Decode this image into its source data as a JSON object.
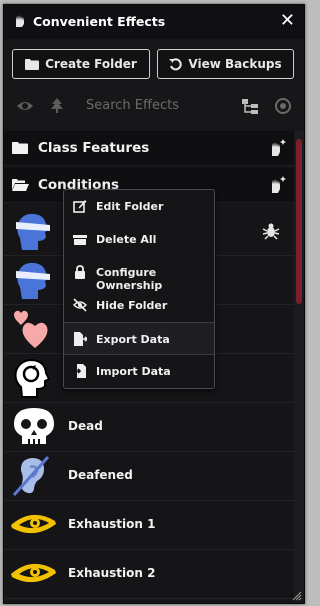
{
  "window": {
    "title": "Convenient Effects",
    "close_glyph": "✕"
  },
  "toolbar": {
    "create_folder": "Create Folder",
    "view_backups": "View Backups"
  },
  "search": {
    "placeholder": "Search Effects"
  },
  "folders": [
    {
      "label": "Class Features"
    },
    {
      "label": "Conditions"
    }
  ],
  "effects": [
    {
      "label": "",
      "icon": "blinded-head-icon"
    },
    {
      "label": "",
      "icon": "blinded-head-icon"
    },
    {
      "label": "",
      "icon": "hearts-icon"
    },
    {
      "label": "",
      "icon": "head-spiral-icon"
    },
    {
      "label": "Dead",
      "icon": "skull-icon"
    },
    {
      "label": "Deafened",
      "icon": "deaf-ear-icon"
    },
    {
      "label": "Exhaustion 1",
      "icon": "yellow-eye-icon"
    },
    {
      "label": "Exhaustion 2",
      "icon": "yellow-eye-icon"
    }
  ],
  "context_menu": {
    "items": [
      {
        "label": "Edit Folder",
        "icon": "edit-icon"
      },
      {
        "label": "Delete All",
        "icon": "trash-icon"
      },
      {
        "label": "Configure Ownership",
        "icon": "lock-icon"
      },
      {
        "label": "Hide Folder",
        "icon": "eye-slash-icon"
      },
      {
        "label": "Export Data",
        "icon": "file-export-icon"
      },
      {
        "label": "Import Data",
        "icon": "file-import-icon"
      }
    ]
  },
  "colors": {
    "accent_scroll": "#7a1f2b",
    "bg": "#17171a",
    "eye_yellow": "#f2c200"
  }
}
